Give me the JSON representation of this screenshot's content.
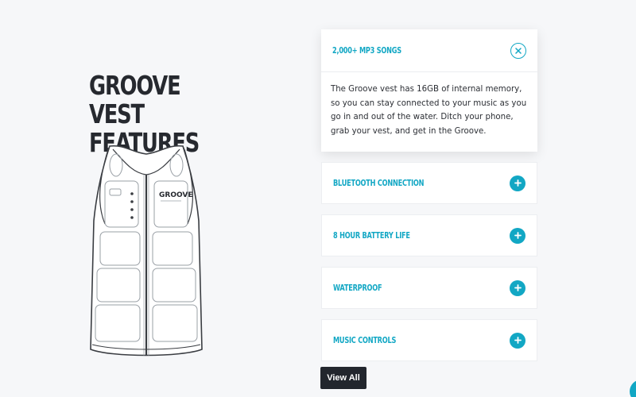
{
  "title": "GROOVE VEST FEATURES",
  "vest_logo_text": "GROOVE",
  "accordion": [
    {
      "label": "2,000+ MP3 Songs",
      "open": true,
      "body": "The Groove vest has 16GB of internal memory, so you can stay connected to your music as you go in and out of the water. Ditch your phone, grab your vest, and get in the Groove."
    },
    {
      "label": "Bluetooth Connection",
      "open": false
    },
    {
      "label": "8 Hour Battery Life",
      "open": false
    },
    {
      "label": "Waterproof",
      "open": false
    },
    {
      "label": "Music Controls",
      "open": false
    }
  ],
  "view_all_label": "View All",
  "colors": {
    "accent": "#12a7c4",
    "heading": "#26292f",
    "button_dark": "#22262d",
    "background": "#f6f7f9"
  },
  "icons": {
    "open_item": "close-icon",
    "closed_item": "plus-icon"
  }
}
